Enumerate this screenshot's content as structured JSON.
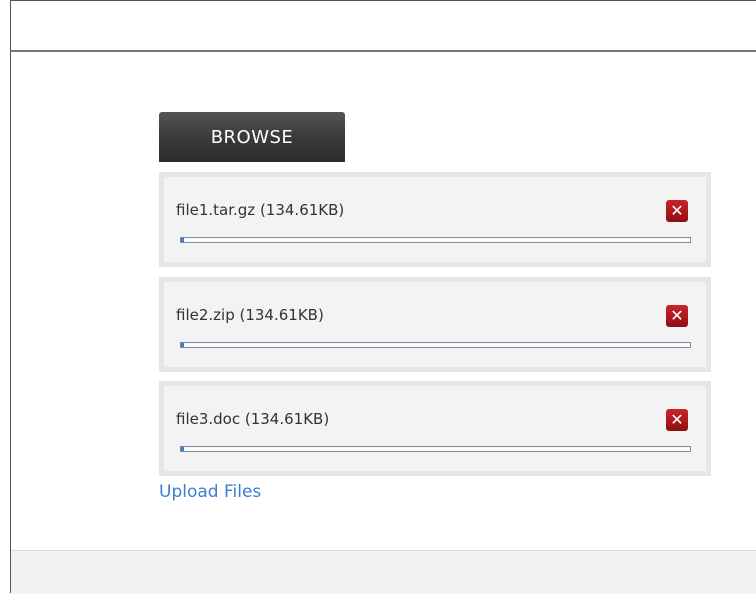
{
  "uploader": {
    "browse_label": "BROWSE",
    "upload_label": "Upload Files",
    "remove_icon": "close-icon",
    "files": [
      {
        "label": "file1.tar.gz (134.61KB)",
        "progress": 0.005
      },
      {
        "label": "file2.zip (134.61KB)",
        "progress": 0.005
      },
      {
        "label": "file3.doc (134.61KB)",
        "progress": 0.005
      }
    ]
  },
  "colors": {
    "accent": "#3b7fd1",
    "remove": "#b01c22",
    "button": "#3a3a3a"
  }
}
